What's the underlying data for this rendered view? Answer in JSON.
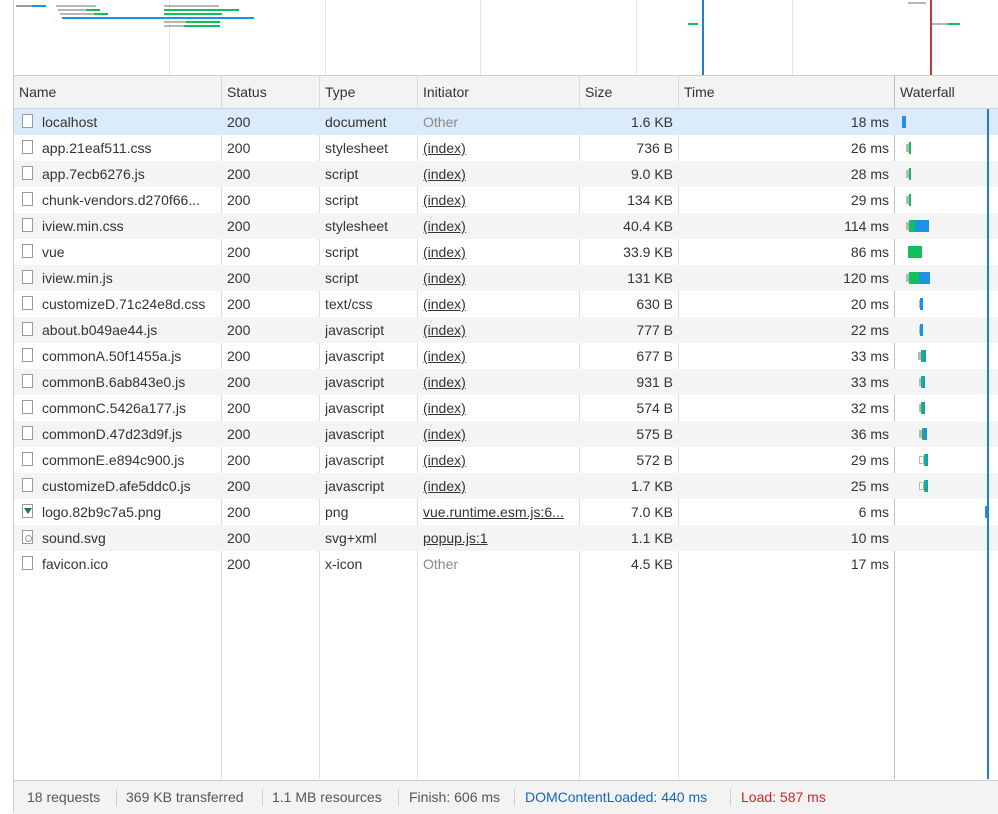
{
  "colors": {
    "waiting": "#b7b7b7",
    "receiving_green": "#10c15a",
    "receiving_blue": "#1e90e6",
    "dom_line": "#1e7fd1",
    "load_line": "#c0392b",
    "dom_text": "#1565c0",
    "load_text": "#c62828"
  },
  "headers": {
    "name": "Name",
    "status": "Status",
    "type": "Type",
    "initiator": "Initiator",
    "size": "Size",
    "time": "Time",
    "waterfall": "Waterfall"
  },
  "requests": [
    {
      "name": "localhost",
      "icon": "document-icon",
      "status": "200",
      "type": "document",
      "initiator": "Other",
      "initiator_kind": "other",
      "size": "1.6 KB",
      "time": "18 ms"
    },
    {
      "name": "app.21eaf511.css",
      "icon": "document-icon",
      "status": "200",
      "type": "stylesheet",
      "initiator": "(index)",
      "initiator_kind": "link",
      "size": "736 B",
      "time": "26 ms"
    },
    {
      "name": "app.7ecb6276.js",
      "icon": "document-icon",
      "status": "200",
      "type": "script",
      "initiator": "(index)",
      "initiator_kind": "link",
      "size": "9.0 KB",
      "time": "28 ms"
    },
    {
      "name": "chunk-vendors.d270f66...",
      "icon": "document-icon",
      "status": "200",
      "type": "script",
      "initiator": "(index)",
      "initiator_kind": "link",
      "size": "134 KB",
      "time": "29 ms"
    },
    {
      "name": "iview.min.css",
      "icon": "document-icon",
      "status": "200",
      "type": "stylesheet",
      "initiator": "(index)",
      "initiator_kind": "link",
      "size": "40.4 KB",
      "time": "114 ms"
    },
    {
      "name": "vue",
      "icon": "document-icon",
      "status": "200",
      "type": "script",
      "initiator": "(index)",
      "initiator_kind": "link",
      "size": "33.9 KB",
      "time": "86 ms"
    },
    {
      "name": "iview.min.js",
      "icon": "document-icon",
      "status": "200",
      "type": "script",
      "initiator": "(index)",
      "initiator_kind": "link",
      "size": "131 KB",
      "time": "120 ms"
    },
    {
      "name": "customizeD.71c24e8d.css",
      "icon": "document-icon",
      "status": "200",
      "type": "text/css",
      "initiator": "(index)",
      "initiator_kind": "link",
      "size": "630 B",
      "time": "20 ms"
    },
    {
      "name": "about.b049ae44.js",
      "icon": "document-icon",
      "status": "200",
      "type": "javascript",
      "initiator": "(index)",
      "initiator_kind": "link",
      "size": "777 B",
      "time": "22 ms"
    },
    {
      "name": "commonA.50f1455a.js",
      "icon": "document-icon",
      "status": "200",
      "type": "javascript",
      "initiator": "(index)",
      "initiator_kind": "link",
      "size": "677 B",
      "time": "33 ms"
    },
    {
      "name": "commonB.6ab843e0.js",
      "icon": "document-icon",
      "status": "200",
      "type": "javascript",
      "initiator": "(index)",
      "initiator_kind": "link",
      "size": "931 B",
      "time": "33 ms"
    },
    {
      "name": "commonC.5426a177.js",
      "icon": "document-icon",
      "status": "200",
      "type": "javascript",
      "initiator": "(index)",
      "initiator_kind": "link",
      "size": "574 B",
      "time": "32 ms"
    },
    {
      "name": "commonD.47d23d9f.js",
      "icon": "document-icon",
      "status": "200",
      "type": "javascript",
      "initiator": "(index)",
      "initiator_kind": "link",
      "size": "575 B",
      "time": "36 ms"
    },
    {
      "name": "commonE.e894c900.js",
      "icon": "document-icon",
      "status": "200",
      "type": "javascript",
      "initiator": "(index)",
      "initiator_kind": "link",
      "size": "572 B",
      "time": "29 ms"
    },
    {
      "name": "customizeD.afe5ddc0.js",
      "icon": "document-icon",
      "status": "200",
      "type": "javascript",
      "initiator": "(index)",
      "initiator_kind": "link",
      "size": "1.7 KB",
      "time": "25 ms"
    },
    {
      "name": "logo.82b9c7a5.png",
      "icon": "image-file-icon",
      "status": "200",
      "type": "png",
      "initiator": "vue.runtime.esm.js:6...",
      "initiator_kind": "link",
      "size": "7.0 KB",
      "time": "6 ms"
    },
    {
      "name": "sound.svg",
      "icon": "svg-file-icon",
      "status": "200",
      "type": "svg+xml",
      "initiator": "popup.js:1",
      "initiator_kind": "link",
      "size": "1.1 KB",
      "time": "10 ms"
    },
    {
      "name": "favicon.ico",
      "icon": "document-icon",
      "status": "200",
      "type": "x-icon",
      "initiator": "Other",
      "initiator_kind": "other",
      "size": "4.5 KB",
      "time": "17 ms"
    }
  ],
  "summary": {
    "requests": "18 requests",
    "transferred": "369 KB transferred",
    "resources": "1.1 MB resources",
    "finish": "Finish: 606 ms",
    "dom_content_loaded": "DOMContentLoaded: 440 ms",
    "load": "Load: 587 ms"
  }
}
